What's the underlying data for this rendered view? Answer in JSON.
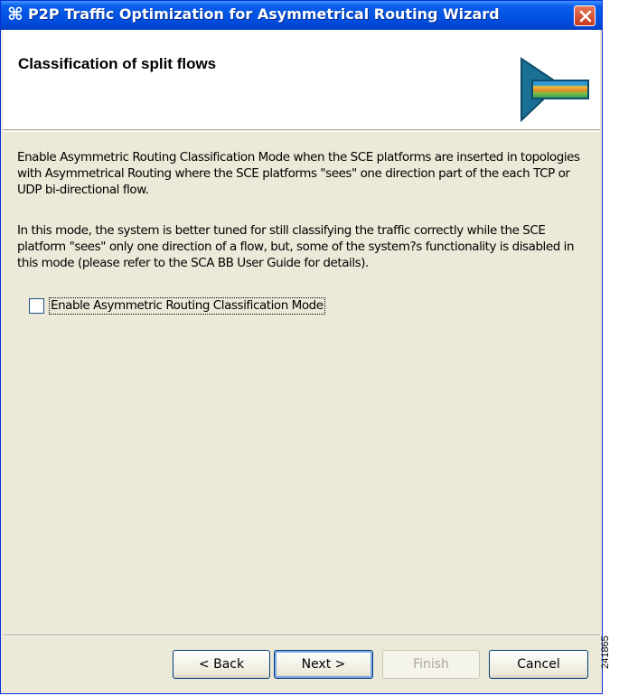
{
  "window": {
    "title": "P2P Traffic Optimization for Asymmetrical Routing Wizard",
    "icon": "cisco-command-icon",
    "close_icon": "close-icon"
  },
  "banner": {
    "title": "Classification of split flows",
    "icon": "wizard-arrow-icon"
  },
  "description": {
    "paragraph1": "Enable Asymmetric Routing Classification Mode when the SCE platforms are inserted in topologies with Asymmetrical Routing where the SCE platforms \"sees\" one direction part of the each TCP or UDP bi-directional flow.",
    "paragraph2": "In this mode, the system is better tuned for still classifying the traffic correctly while the SCE platform \"sees\" only one direction of a flow, but, some of the system?s functionality is disabled in this mode (please refer to the SCA BB User Guide for details)."
  },
  "option": {
    "label": "Enable Asymmetric Routing Classification Mode",
    "checked": false
  },
  "buttons": {
    "back": "< Back",
    "next": "Next >",
    "finish": "Finish",
    "cancel": "Cancel"
  },
  "figure_number": "241865",
  "colors": {
    "titlebar": "#0255e4",
    "window_bg": "#ece9d8",
    "close_button": "#c8391a"
  }
}
